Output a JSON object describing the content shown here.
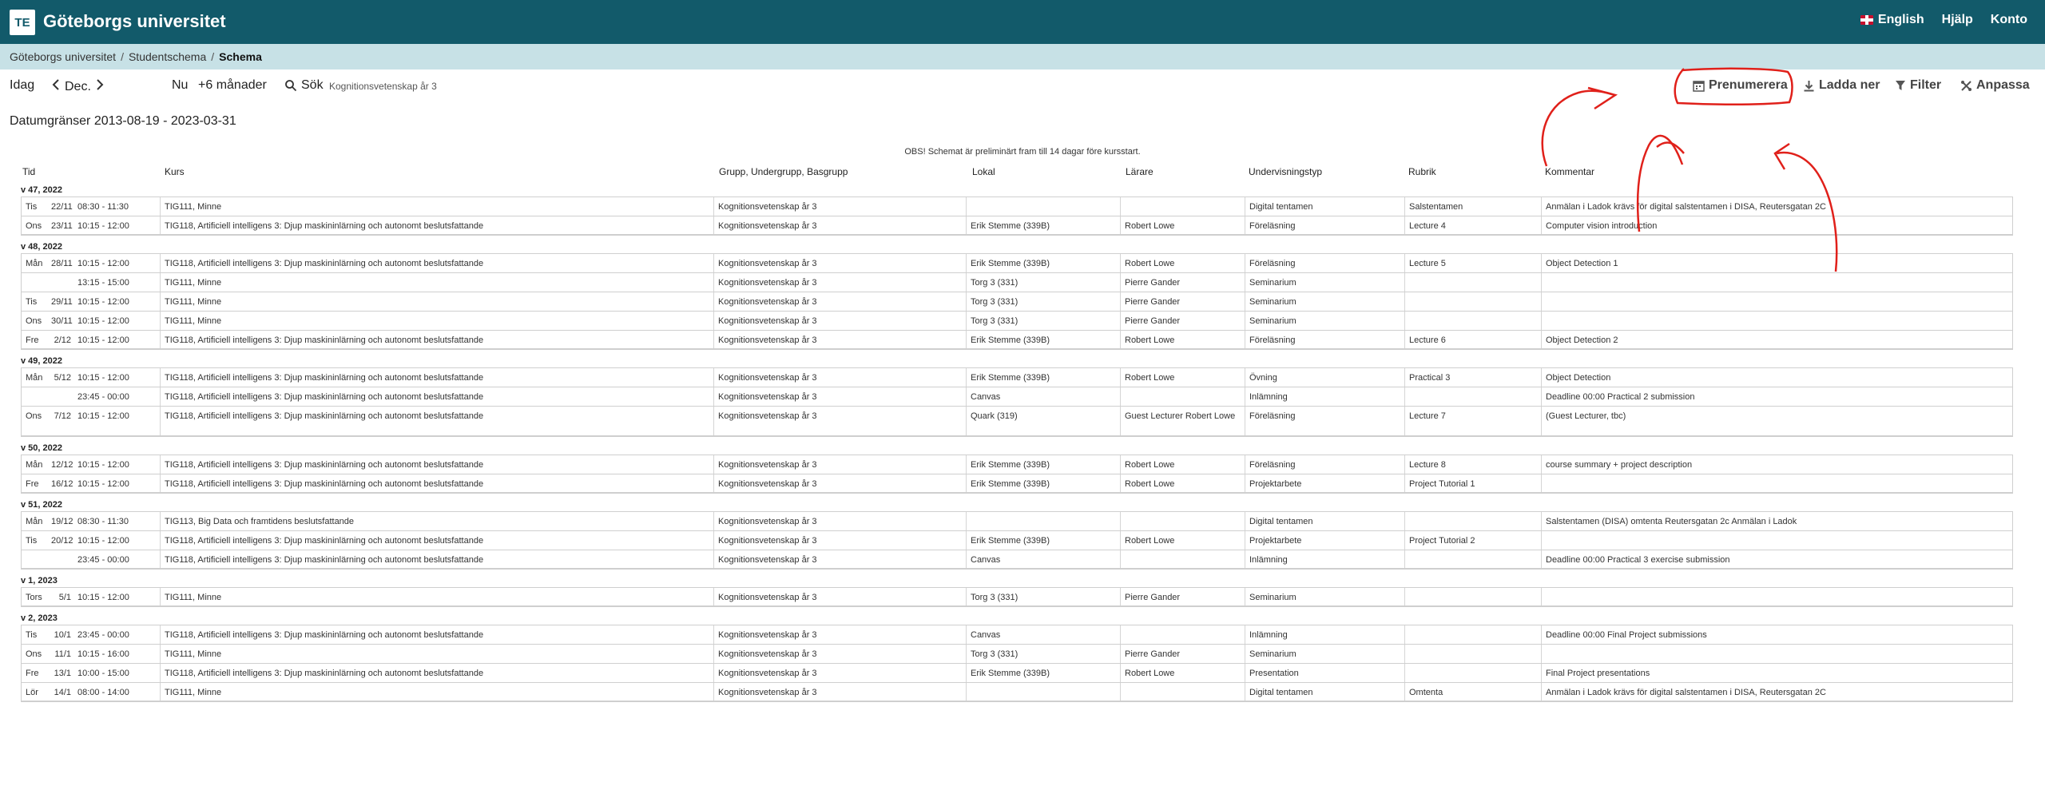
{
  "header": {
    "logo_text": "TE",
    "title": "Göteborgs universitet",
    "links": [
      "English",
      "Hjälp",
      "Konto"
    ]
  },
  "breadcrumb": {
    "items": [
      "Göteborgs universitet",
      "Studentschema"
    ],
    "current": "Schema"
  },
  "toolbar": {
    "today": "Idag",
    "month": "Dec.",
    "now": "Nu",
    "range": "+6 månader",
    "search": "Sök",
    "search_value": "Kognitionsvetenskap år 3",
    "subscribe": "Prenumerera",
    "download": "Ladda ner",
    "filter": "Filter",
    "customize": "Anpassa"
  },
  "date_range": "Datumgränser 2013-08-19 - 2023-03-31",
  "notice": "OBS! Schemat är preliminärt fram till 14 dagar före kursstart.",
  "columns": [
    "Tid",
    "Kurs",
    "Grupp, Undergrupp, Basgrupp",
    "Lokal",
    "Lärare",
    "Undervisningstyp",
    "Rubrik",
    "Kommentar"
  ],
  "weeks": [
    {
      "label": "v 47, 2022",
      "rows": [
        {
          "day": "Tis",
          "date": "22/11",
          "time": "08:30 - 11:30",
          "course": "TIG111, Minne",
          "group": "Kognitionsvetenskap år 3",
          "room": "",
          "teacher": "",
          "type": "Digital tentamen",
          "rubrik": "Salstentamen",
          "comment": "Anmälan i Ladok krävs för digital salstentamen i DISA, Reutersgatan 2C"
        },
        {
          "day": "Ons",
          "date": "23/11",
          "time": "10:15 - 12:00",
          "course": "TIG118, Artificiell intelligens 3: Djup maskininlärning och autonomt beslutsfattande",
          "group": "Kognitionsvetenskap år 3",
          "room": "Erik Stemme (339B)",
          "teacher": "Robert Lowe",
          "type": "Föreläsning",
          "rubrik": "Lecture 4",
          "comment": "Computer vision introduction"
        }
      ]
    },
    {
      "label": "v 48, 2022",
      "rows": [
        {
          "day": "Mån",
          "date": "28/11",
          "time": "10:15 - 12:00",
          "course": "TIG118, Artificiell intelligens 3: Djup maskininlärning och autonomt beslutsfattande",
          "group": "Kognitionsvetenskap år 3",
          "room": "Erik Stemme (339B)",
          "teacher": "Robert Lowe",
          "type": "Föreläsning",
          "rubrik": "Lecture 5",
          "comment": "Object Detection 1"
        },
        {
          "day": "",
          "date": "",
          "time": "13:15 - 15:00",
          "course": "TIG111, Minne",
          "group": "Kognitionsvetenskap år 3",
          "room": "Torg 3 (331)",
          "teacher": "Pierre Gander",
          "type": "Seminarium",
          "rubrik": "",
          "comment": ""
        },
        {
          "day": "Tis",
          "date": "29/11",
          "time": "10:15 - 12:00",
          "course": "TIG111, Minne",
          "group": "Kognitionsvetenskap år 3",
          "room": "Torg 3 (331)",
          "teacher": "Pierre Gander",
          "type": "Seminarium",
          "rubrik": "",
          "comment": ""
        },
        {
          "day": "Ons",
          "date": "30/11",
          "time": "10:15 - 12:00",
          "course": "TIG111, Minne",
          "group": "Kognitionsvetenskap år 3",
          "room": "Torg 3 (331)",
          "teacher": "Pierre Gander",
          "type": "Seminarium",
          "rubrik": "",
          "comment": ""
        },
        {
          "day": "Fre",
          "date": "2/12",
          "time": "10:15 - 12:00",
          "course": "TIG118, Artificiell intelligens 3: Djup maskininlärning och autonomt beslutsfattande",
          "group": "Kognitionsvetenskap år 3",
          "room": "Erik Stemme (339B)",
          "teacher": "Robert Lowe",
          "type": "Föreläsning",
          "rubrik": "Lecture 6",
          "comment": "Object Detection 2"
        }
      ]
    },
    {
      "label": "v 49, 2022",
      "rows": [
        {
          "day": "Mån",
          "date": "5/12",
          "time": "10:15 - 12:00",
          "course": "TIG118, Artificiell intelligens 3: Djup maskininlärning och autonomt beslutsfattande",
          "group": "Kognitionsvetenskap år 3",
          "room": "Erik Stemme (339B)",
          "teacher": "Robert Lowe",
          "type": "Övning",
          "rubrik": "Practical 3",
          "comment": "Object Detection"
        },
        {
          "day": "",
          "date": "",
          "time": "23:45 - 00:00",
          "course": "TIG118, Artificiell intelligens 3: Djup maskininlärning och autonomt beslutsfattande",
          "group": "Kognitionsvetenskap år 3",
          "room": "Canvas",
          "teacher": "",
          "type": "Inlämning",
          "rubrik": "",
          "comment": "Deadline 00:00 Practical 2 submission"
        },
        {
          "day": "Ons",
          "date": "7/12",
          "time": "10:15 - 12:00",
          "course": "TIG118, Artificiell intelligens 3: Djup maskininlärning och autonomt beslutsfattande",
          "group": "Kognitionsvetenskap år 3",
          "room": "Quark (319)",
          "teacher": "Guest Lecturer Robert Lowe",
          "type": "Föreläsning",
          "rubrik": "Lecture 7",
          "comment": "(Guest Lecturer, tbc)"
        }
      ]
    },
    {
      "label": "v 50, 2022",
      "rows": [
        {
          "day": "Mån",
          "date": "12/12",
          "time": "10:15 - 12:00",
          "course": "TIG118, Artificiell intelligens 3: Djup maskininlärning och autonomt beslutsfattande",
          "group": "Kognitionsvetenskap år 3",
          "room": "Erik Stemme (339B)",
          "teacher": "Robert Lowe",
          "type": "Föreläsning",
          "rubrik": "Lecture 8",
          "comment": "course summary + project description"
        },
        {
          "day": "Fre",
          "date": "16/12",
          "time": "10:15 - 12:00",
          "course": "TIG118, Artificiell intelligens 3: Djup maskininlärning och autonomt beslutsfattande",
          "group": "Kognitionsvetenskap år 3",
          "room": "Erik Stemme (339B)",
          "teacher": "Robert Lowe",
          "type": "Projektarbete",
          "rubrik": "Project Tutorial 1",
          "comment": ""
        }
      ]
    },
    {
      "label": "v 51, 2022",
      "rows": [
        {
          "day": "Mån",
          "date": "19/12",
          "time": "08:30 - 11:30",
          "course": "TIG113, Big Data och framtidens beslutsfattande",
          "group": "Kognitionsvetenskap år 3",
          "room": "",
          "teacher": "",
          "type": "Digital tentamen",
          "rubrik": "",
          "comment": "Salstentamen (DISA) omtenta Reutersgatan 2c Anmälan i Ladok"
        },
        {
          "day": "Tis",
          "date": "20/12",
          "time": "10:15 - 12:00",
          "course": "TIG118, Artificiell intelligens 3: Djup maskininlärning och autonomt beslutsfattande",
          "group": "Kognitionsvetenskap år 3",
          "room": "Erik Stemme (339B)",
          "teacher": "Robert Lowe",
          "type": "Projektarbete",
          "rubrik": "Project Tutorial 2",
          "comment": ""
        },
        {
          "day": "",
          "date": "",
          "time": "23:45 - 00:00",
          "course": "TIG118, Artificiell intelligens 3: Djup maskininlärning och autonomt beslutsfattande",
          "group": "Kognitionsvetenskap år 3",
          "room": "Canvas",
          "teacher": "",
          "type": "Inlämning",
          "rubrik": "",
          "comment": "Deadline 00:00 Practical 3 exercise submission"
        }
      ]
    },
    {
      "label": "v 1, 2023",
      "rows": [
        {
          "day": "Tors",
          "date": "5/1",
          "time": "10:15 - 12:00",
          "course": "TIG111, Minne",
          "group": "Kognitionsvetenskap år 3",
          "room": "Torg 3 (331)",
          "teacher": "Pierre Gander",
          "type": "Seminarium",
          "rubrik": "",
          "comment": ""
        }
      ]
    },
    {
      "label": "v 2, 2023",
      "rows": [
        {
          "day": "Tis",
          "date": "10/1",
          "time": "23:45 - 00:00",
          "course": "TIG118, Artificiell intelligens 3: Djup maskininlärning och autonomt beslutsfattande",
          "group": "Kognitionsvetenskap år 3",
          "room": "Canvas",
          "teacher": "",
          "type": "Inlämning",
          "rubrik": "",
          "comment": "Deadline 00:00 Final Project submissions"
        },
        {
          "day": "Ons",
          "date": "11/1",
          "time": "10:15 - 16:00",
          "course": "TIG111, Minne",
          "group": "Kognitionsvetenskap år 3",
          "room": "Torg 3 (331)",
          "teacher": "Pierre Gander",
          "type": "Seminarium",
          "rubrik": "",
          "comment": ""
        },
        {
          "day": "Fre",
          "date": "13/1",
          "time": "10:00 - 15:00",
          "course": "TIG118, Artificiell intelligens 3: Djup maskininlärning och autonomt beslutsfattande",
          "group": "Kognitionsvetenskap år 3",
          "room": "Erik Stemme (339B)",
          "teacher": "Robert Lowe",
          "type": "Presentation",
          "rubrik": "",
          "comment": "Final Project presentations"
        },
        {
          "day": "Lör",
          "date": "14/1",
          "time": "08:00 - 14:00",
          "course": "TIG111, Minne",
          "group": "Kognitionsvetenskap år 3",
          "room": "",
          "teacher": "",
          "type": "Digital tentamen",
          "rubrik": "Omtenta",
          "comment": "Anmälan i Ladok krävs för digital salstentamen i DISA, Reutersgatan 2C"
        }
      ]
    }
  ]
}
